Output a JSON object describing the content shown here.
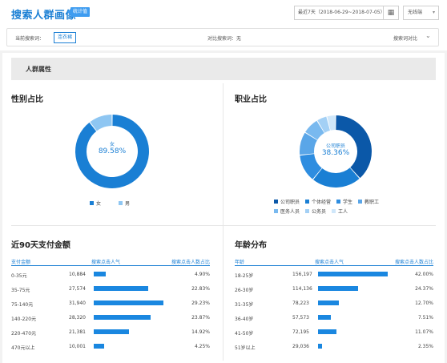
{
  "header": {
    "title": "搜索人群画像",
    "tag": "统计值",
    "date_range": "最近7天（2018-06-29~2018-07-05）",
    "calendar_icon": "calendar-icon",
    "terminal_select": "无线端"
  },
  "compare": {
    "current_label": "当前搜索词：",
    "current_keyword": "连衣裙",
    "compare_label": "对比搜索词：无",
    "compare_action": "搜索词对比"
  },
  "section": {
    "title": "人群属性"
  },
  "gender": {
    "title": "性别占比",
    "center_name": "女",
    "center_value": "89.58%",
    "legend": [
      {
        "label": "女",
        "color": "#1a7fd4"
      },
      {
        "label": "男",
        "color": "#8ec6f2"
      }
    ],
    "slices": [
      {
        "label": "女",
        "value": 89.58,
        "color": "#1a7fd4"
      },
      {
        "label": "男",
        "value": 10.42,
        "color": "#8ec6f2"
      }
    ]
  },
  "occupation": {
    "title": "职业占比",
    "center_name": "公司职员",
    "center_value": "38.36%",
    "legend": [
      {
        "label": "公司职员",
        "color": "#0b58a8"
      },
      {
        "label": "个体经营",
        "color": "#1a7fd4"
      },
      {
        "label": "学生",
        "color": "#2e8de0"
      },
      {
        "label": "教职工",
        "color": "#5aa6e8"
      },
      {
        "label": "医务人员",
        "color": "#79b9ef"
      },
      {
        "label": "公务员",
        "color": "#a3d0f5"
      },
      {
        "label": "工人",
        "color": "#cfe7fa"
      }
    ],
    "slices": [
      {
        "label": "公司职员",
        "value": 38.36,
        "color": "#0b58a8"
      },
      {
        "label": "个体经营",
        "value": 22.5,
        "color": "#1a7fd4"
      },
      {
        "label": "学生",
        "value": 12.5,
        "color": "#2e8de0"
      },
      {
        "label": "教职工",
        "value": 10.5,
        "color": "#5aa6e8"
      },
      {
        "label": "医务人员",
        "value": 7.5,
        "color": "#79b9ef"
      },
      {
        "label": "公务员",
        "value": 4.64,
        "color": "#a3d0f5"
      },
      {
        "label": "工人",
        "value": 4.0,
        "color": "#cfe7fa"
      }
    ]
  },
  "payment": {
    "title": "近90天支付金额",
    "headers": [
      "支付金额",
      "搜索点击人气",
      "搜索点击人数占比"
    ],
    "rows": [
      {
        "range": "0-35元",
        "popularity": "10,884",
        "pct": "4.90%"
      },
      {
        "range": "35-75元",
        "popularity": "27,574",
        "pct": "22.83%"
      },
      {
        "range": "75-140元",
        "popularity": "31,940",
        "pct": "29.23%"
      },
      {
        "range": "140-220元",
        "popularity": "28,320",
        "pct": "23.87%"
      },
      {
        "range": "220-470元",
        "popularity": "21,381",
        "pct": "14.92%"
      },
      {
        "range": "470元以上",
        "popularity": "10,001",
        "pct": "4.25%"
      }
    ]
  },
  "age": {
    "title": "年龄分布",
    "headers": [
      "年龄",
      "搜索点击人气",
      "搜索点击人数占比"
    ],
    "rows": [
      {
        "range": "18-25岁",
        "popularity": "156,197",
        "pct": "42.00%"
      },
      {
        "range": "26-30岁",
        "popularity": "114,136",
        "pct": "24.37%"
      },
      {
        "range": "31-35岁",
        "popularity": "78,223",
        "pct": "12.70%"
      },
      {
        "range": "36-40岁",
        "popularity": "57,573",
        "pct": "7.51%"
      },
      {
        "range": "41-50岁",
        "popularity": "72,195",
        "pct": "11.07%"
      },
      {
        "range": "51岁以上",
        "popularity": "29,036",
        "pct": "2.35%"
      }
    ]
  },
  "chart_data": [
    {
      "type": "pie",
      "title": "性别占比",
      "categories": [
        "女",
        "男"
      ],
      "values": [
        89.58,
        10.42
      ]
    },
    {
      "type": "pie",
      "title": "职业占比",
      "categories": [
        "公司职员",
        "个体经营",
        "学生",
        "教职工",
        "医务人员",
        "公务员",
        "工人"
      ],
      "values": [
        38.36,
        22.5,
        12.5,
        10.5,
        7.5,
        4.64,
        4.0
      ]
    },
    {
      "type": "bar",
      "title": "近90天支付金额",
      "categories": [
        "0-35元",
        "35-75元",
        "75-140元",
        "140-220元",
        "220-470元",
        "470元以上"
      ],
      "values": [
        10884,
        27574,
        31940,
        28320,
        21381,
        10001
      ]
    },
    {
      "type": "bar",
      "title": "年龄分布",
      "categories": [
        "18-25岁",
        "26-30岁",
        "31-35岁",
        "36-40岁",
        "41-50岁",
        "51岁以上"
      ],
      "values": [
        156197,
        114136,
        78223,
        57573,
        72195,
        29036
      ]
    }
  ]
}
